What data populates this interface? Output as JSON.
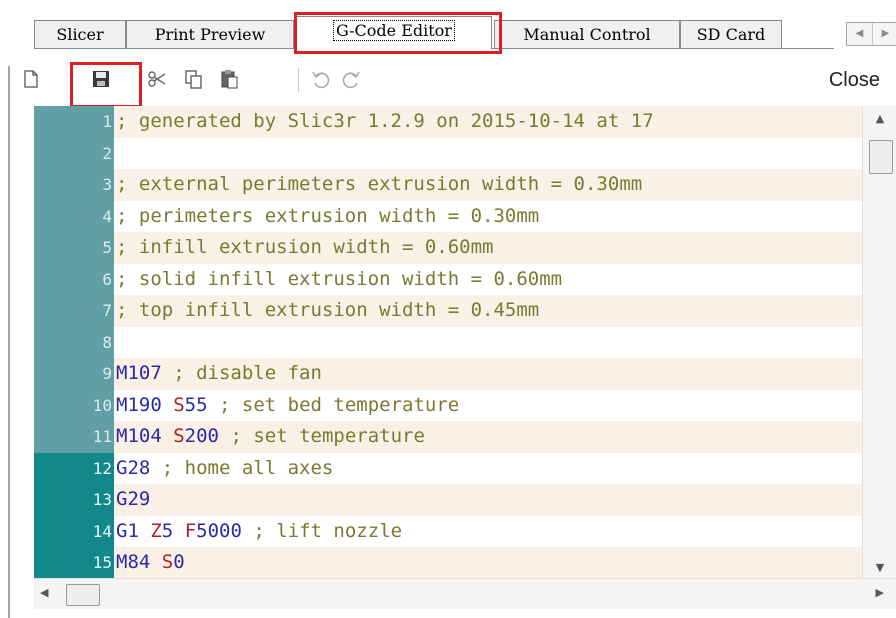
{
  "tabs": [
    {
      "label": "Slicer"
    },
    {
      "label": "Print Preview"
    },
    {
      "label": "G-Code Editor"
    },
    {
      "label": "Manual Control"
    },
    {
      "label": "SD Card"
    }
  ],
  "active_tab": "G-Code Editor",
  "toolbar": {
    "icons": [
      "new-file-icon",
      "save-icon",
      "cut-icon",
      "copy-icon",
      "paste-icon",
      "undo-icon",
      "redo-icon"
    ],
    "close_label": "Close"
  },
  "highlight_color": "#e02020",
  "gutter_color": "#5f9fa5",
  "gutter_selected_color": "#12888a",
  "editor": {
    "lines": [
      {
        "num": "1",
        "parts": [
          {
            "t": "; generated by Slic3r 1.2.9 on 2015-10-14 at 17",
            "k": "c"
          }
        ]
      },
      {
        "num": "2",
        "parts": []
      },
      {
        "num": "3",
        "parts": [
          {
            "t": "; external perimeters extrusion width = 0.30mm",
            "k": "c"
          }
        ]
      },
      {
        "num": "4",
        "parts": [
          {
            "t": "; perimeters extrusion width = 0.30mm",
            "k": "c"
          }
        ]
      },
      {
        "num": "5",
        "parts": [
          {
            "t": "; infill extrusion width = 0.60mm",
            "k": "c"
          }
        ]
      },
      {
        "num": "6",
        "parts": [
          {
            "t": "; solid infill extrusion width = 0.60mm",
            "k": "c"
          }
        ]
      },
      {
        "num": "7",
        "parts": [
          {
            "t": "; top infill extrusion width = 0.45mm",
            "k": "c"
          }
        ]
      },
      {
        "num": "8",
        "parts": []
      },
      {
        "num": "9",
        "parts": [
          {
            "t": "M107",
            "k": "kw"
          },
          {
            "t": " ; disable fan",
            "k": "c"
          }
        ]
      },
      {
        "num": "10",
        "parts": [
          {
            "t": "M190",
            "k": "kw"
          },
          {
            "t": " ",
            "k": "pl"
          },
          {
            "t": "S",
            "k": "pm"
          },
          {
            "t": "55",
            "k": "kw"
          },
          {
            "t": " ; set bed temperature",
            "k": "c"
          }
        ]
      },
      {
        "num": "11",
        "parts": [
          {
            "t": "M104",
            "k": "kw"
          },
          {
            "t": " ",
            "k": "pl"
          },
          {
            "t": "S",
            "k": "pm"
          },
          {
            "t": "200",
            "k": "kw"
          },
          {
            "t": " ; set temperature",
            "k": "c"
          }
        ]
      },
      {
        "num": "12",
        "parts": [
          {
            "t": "G28",
            "k": "kw"
          },
          {
            "t": " ; home all axes",
            "k": "c"
          }
        ]
      },
      {
        "num": "13",
        "parts": [
          {
            "t": "G29",
            "k": "kw"
          }
        ]
      },
      {
        "num": "14",
        "parts": [
          {
            "t": "G1",
            "k": "kw"
          },
          {
            "t": " ",
            "k": "pl"
          },
          {
            "t": "Z",
            "k": "pm"
          },
          {
            "t": "5",
            "k": "kw"
          },
          {
            "t": " ",
            "k": "pl"
          },
          {
            "t": "F",
            "k": "pm"
          },
          {
            "t": "5000",
            "k": "kw"
          },
          {
            "t": " ; lift nozzle",
            "k": "c"
          }
        ]
      },
      {
        "num": "15",
        "parts": [
          {
            "t": "M84",
            "k": "kw"
          },
          {
            "t": " ",
            "k": "pl"
          },
          {
            "t": "S",
            "k": "pm"
          },
          {
            "t": "0",
            "k": "kw"
          }
        ]
      }
    ],
    "selected_lines_from": 12
  }
}
